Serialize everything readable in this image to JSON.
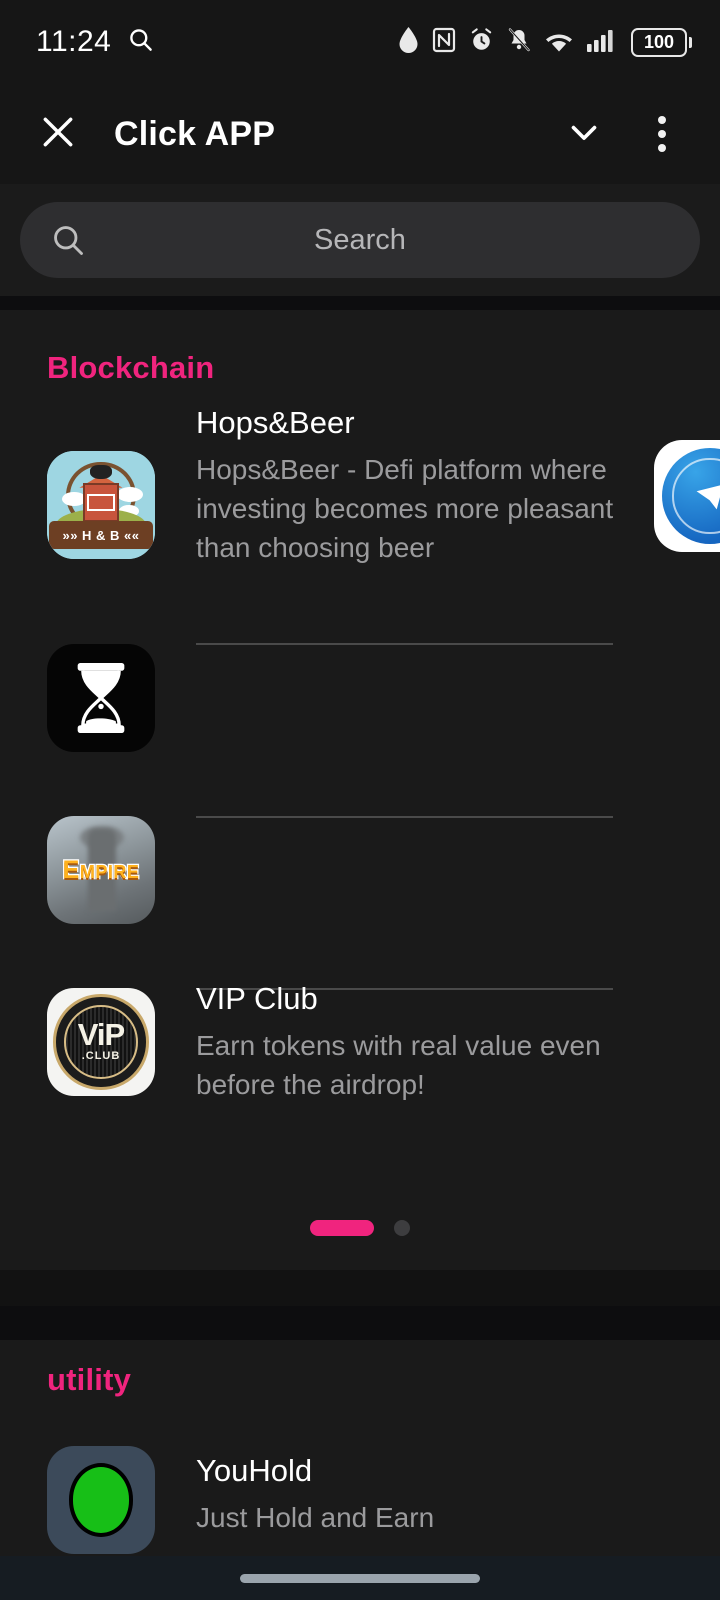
{
  "status_bar": {
    "time": "11:24",
    "left_icons": [
      "search-icon"
    ],
    "right_icons": [
      "water-drop-icon",
      "nfc-icon",
      "alarm-clock-icon",
      "bell-muted-icon",
      "wifi-icon",
      "cellular-signal-icon"
    ],
    "battery_level": "100"
  },
  "app_bar": {
    "title": "Click APP",
    "close_icon": "close-icon",
    "chevron_icon": "chevron-down-icon",
    "overflow_icon": "kebab-menu-icon"
  },
  "search": {
    "placeholder": "Search",
    "value": "",
    "icon": "search-icon"
  },
  "sections": [
    {
      "title": "Blockchain",
      "accent_color": "#f0247e",
      "apps": [
        {
          "name": "Hops&Beer",
          "description": "Hops&Beer - Defi platform where investing becomes more pleasant than choosing beer",
          "icon": "hops-and-beer-barn-icon",
          "icon_caption": "»» H & B ««"
        },
        {
          "name": "",
          "description": "",
          "icon": "hourglass-icon",
          "icon_caption": ""
        },
        {
          "name": "",
          "description": "",
          "icon": "empire-icon",
          "icon_caption": "Empire"
        },
        {
          "name": "VIP Club",
          "description": "Earn tokens with real value even before the airdrop!",
          "icon": "vip-club-icon",
          "icon_caption": "ViP",
          "icon_subcaption": ".CLUB"
        }
      ],
      "pager": {
        "pages": 2,
        "active_index": 0
      }
    },
    {
      "title": "utility",
      "accent_color": "#f0247e",
      "apps": [
        {
          "name": "YouHold",
          "description": "Just Hold and Earn",
          "icon": "youhold-green-circle-icon",
          "icon_caption": ""
        }
      ]
    }
  ],
  "peek_card": {
    "icon": "telegram-blue-icon"
  },
  "nav_bar": {
    "gesture_pill": "home-indicator"
  },
  "colors": {
    "background": "#121212",
    "surface": "#1a1a1a",
    "band": "#0d0d0f",
    "accent_pink": "#f0247e",
    "text_primary": "#ffffff",
    "text_secondary": "#9b9b9d",
    "search_field": "#2e2e30"
  }
}
